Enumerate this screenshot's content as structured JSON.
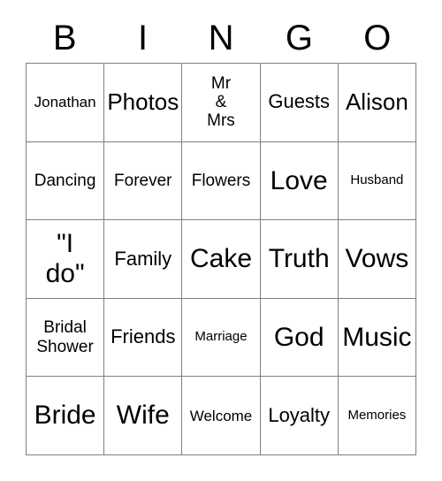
{
  "card": {
    "title": "BINGO",
    "headers": [
      "B",
      "I",
      "N",
      "G",
      "O"
    ],
    "rows": [
      [
        {
          "text": "Jonathan",
          "size": "fs-s"
        },
        {
          "text": "Photos",
          "size": "fs-xl"
        },
        {
          "text": "Mr\n&\nMrs",
          "size": "fs-m"
        },
        {
          "text": "Guests",
          "size": "fs-l"
        },
        {
          "text": "Alison",
          "size": "fs-xl"
        }
      ],
      [
        {
          "text": "Dancing",
          "size": "fs-m"
        },
        {
          "text": "Forever",
          "size": "fs-m"
        },
        {
          "text": "Flowers",
          "size": "fs-m"
        },
        {
          "text": "Love",
          "size": "fs-xxl"
        },
        {
          "text": "Husband",
          "size": "fs-xs"
        }
      ],
      [
        {
          "text": "\"I\ndo\"",
          "size": "fs-xxl"
        },
        {
          "text": "Family",
          "size": "fs-l"
        },
        {
          "text": "Cake",
          "size": "fs-xxl"
        },
        {
          "text": "Truth",
          "size": "fs-xxl"
        },
        {
          "text": "Vows",
          "size": "fs-xxl"
        }
      ],
      [
        {
          "text": "Bridal\nShower",
          "size": "fs-m"
        },
        {
          "text": "Friends",
          "size": "fs-l"
        },
        {
          "text": "Marriage",
          "size": "fs-xs"
        },
        {
          "text": "God",
          "size": "fs-xxl"
        },
        {
          "text": "Music",
          "size": "fs-xxl"
        }
      ],
      [
        {
          "text": "Bride",
          "size": "fs-xxl"
        },
        {
          "text": "Wife",
          "size": "fs-xxl"
        },
        {
          "text": "Welcome",
          "size": "fs-s"
        },
        {
          "text": "Loyalty",
          "size": "fs-l"
        },
        {
          "text": "Memories",
          "size": "fs-xs"
        }
      ]
    ]
  },
  "colors": {
    "grid_line": "#808080",
    "text": "#000000",
    "background": "#ffffff"
  }
}
